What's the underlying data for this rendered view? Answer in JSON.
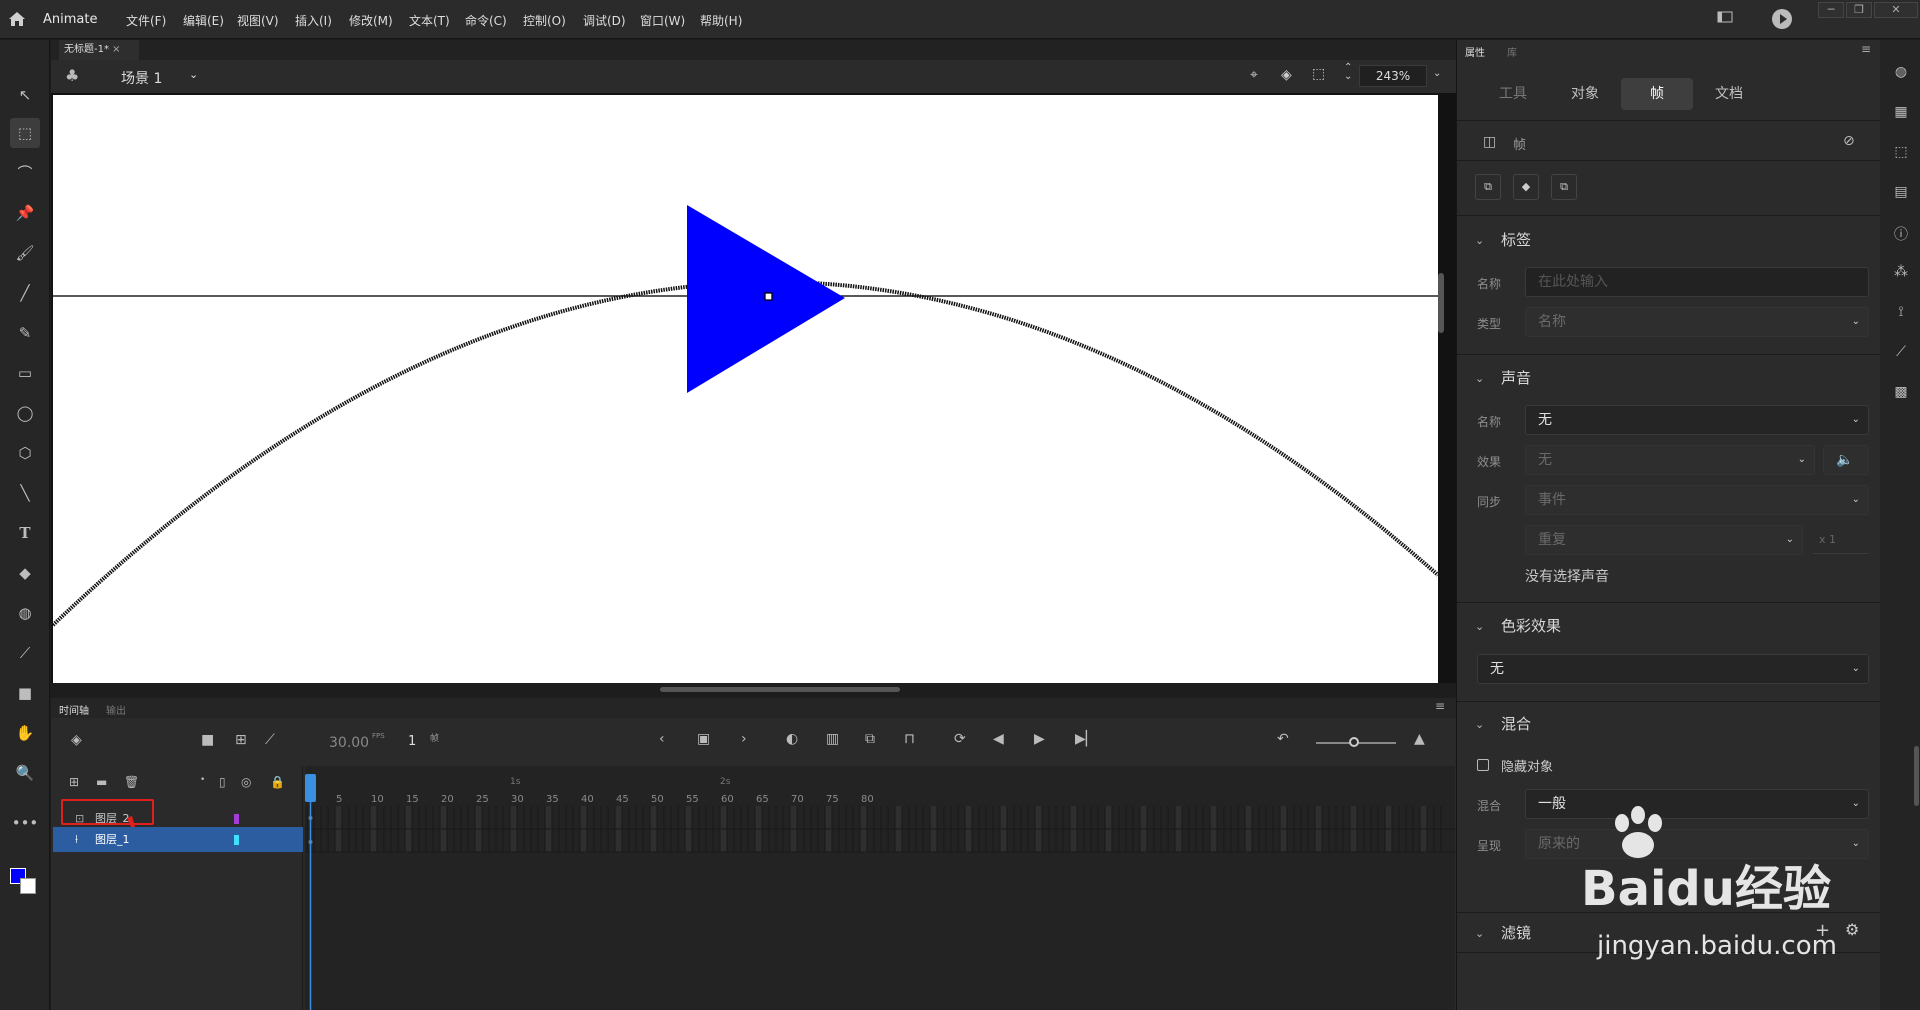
{
  "app": {
    "name": "Animate"
  },
  "menu": [
    "文件(F)",
    "编辑(E)",
    "视图(V)",
    "插入(I)",
    "修改(M)",
    "文本(T)",
    "命令(C)",
    "控制(O)",
    "调试(D)",
    "窗口(W)",
    "帮助(H)"
  ],
  "document": {
    "tab": "无标题-1*",
    "scene": "场景 1",
    "zoom": "243%"
  },
  "timeline": {
    "tab": "时间轴",
    "tab2": "输出",
    "fps": "30.00",
    "fps_unit": "FPS",
    "frame": "1",
    "frame_unit": "帧",
    "ruler": [
      "5",
      "10",
      "15",
      "20",
      "25",
      "30",
      "35",
      "40",
      "45",
      "50",
      "55",
      "60",
      "65",
      "70",
      "75",
      "80"
    ],
    "seconds": [
      "1s",
      "2s"
    ],
    "layers": [
      {
        "name": "图层_2",
        "color": "#a43cd8"
      },
      {
        "name": "图层_1",
        "color": "#3fe0ff"
      }
    ]
  },
  "properties": {
    "tab": "属性",
    "tab2": "库",
    "tabs": [
      "工具",
      "对象",
      "帧",
      "文档"
    ],
    "active_tab": "帧",
    "frame_label": "帧",
    "label_section": {
      "title": "标签",
      "name_label": "名称",
      "name_placeholder": "在此处输入",
      "type_label": "类型",
      "type_value": "名称"
    },
    "sound_section": {
      "title": "声音",
      "name_label": "名称",
      "name_value": "无",
      "effect_label": "效果",
      "effect_value": "无",
      "sync_label": "同步",
      "sync_value": "事件",
      "repeat_value": "重复",
      "repeat_count": "x 1",
      "no_sound": "没有选择声音"
    },
    "color_section": {
      "title": "色彩效果",
      "value": "无"
    },
    "blend_section": {
      "title": "混合",
      "hide_object": "隐藏对象",
      "blend_label": "混合",
      "blend_value": "一般",
      "render_label": "呈现",
      "render_value": "原来的"
    },
    "filter_section": {
      "title": "滤镜"
    }
  },
  "colors": {
    "accent": "#0000ff",
    "selection": "#2d5da1",
    "playhead": "#3b8fe0"
  },
  "watermark": {
    "text": "Baidu经验",
    "url": "jingyan.baidu.com"
  }
}
